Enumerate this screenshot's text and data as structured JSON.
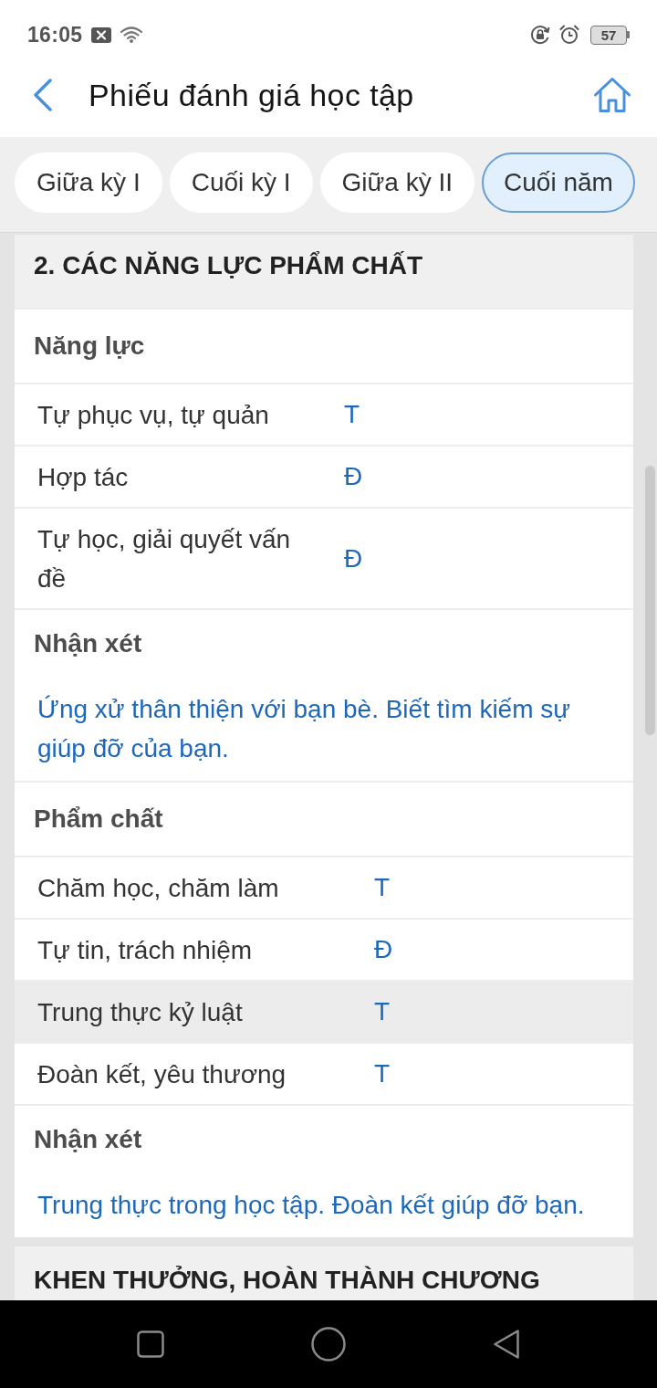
{
  "status_bar": {
    "time": "16:05",
    "battery": "57"
  },
  "header": {
    "title": "Phiếu đánh giá học tập"
  },
  "tabs": [
    {
      "label": "Giữa kỳ I",
      "selected": false
    },
    {
      "label": "Cuối kỳ I",
      "selected": false
    },
    {
      "label": "Giữa kỳ II",
      "selected": false
    },
    {
      "label": "Cuối năm",
      "selected": true
    }
  ],
  "section": {
    "title": "2. CÁC NĂNG LỰC PHẨM CHẤT",
    "groups": [
      {
        "title": "Năng lực",
        "rows": [
          {
            "label": "Tự phục vụ, tự quản",
            "value": "T",
            "selected": false
          },
          {
            "label": "Hợp tác",
            "value": "Đ",
            "selected": false
          },
          {
            "label": "Tự học, giải quyết vấn đề",
            "value": "Đ",
            "selected": false
          }
        ],
        "comment": {
          "label": "Nhận xét",
          "text": "Ứng xử thân thiện với bạn bè. Biết tìm kiếm sự giúp đỡ của bạn."
        }
      },
      {
        "title": "Phẩm chất",
        "rows": [
          {
            "label": "Chăm học, chăm làm",
            "value": "T",
            "selected": false
          },
          {
            "label": "Tự tin, trách nhiệm",
            "value": "Đ",
            "selected": false
          },
          {
            "label": "Trung thực kỷ luật",
            "value": "T",
            "selected": true
          },
          {
            "label": "Đoàn kết, yêu thương",
            "value": "T",
            "selected": false
          }
        ],
        "comment": {
          "label": "Nhận xét",
          "text": "Trung thực trong học tập. Đoàn kết giúp đỡ bạn."
        }
      }
    ]
  },
  "next_section": {
    "title": "KHEN THƯỞNG, HOÀN THÀNH CHƯƠNG"
  }
}
